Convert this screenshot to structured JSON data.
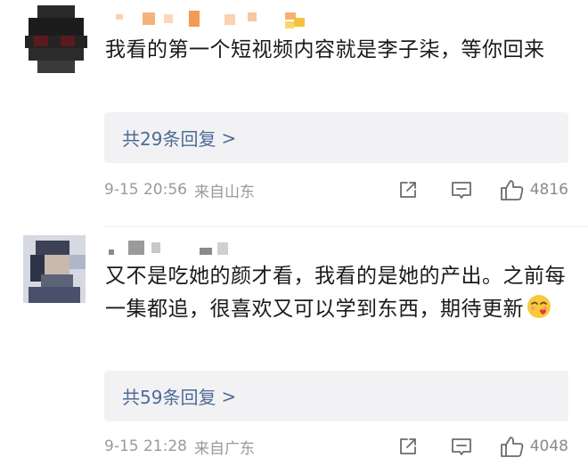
{
  "comments": [
    {
      "text": "我看的第一个短视频内容就是李子柒，等你回来",
      "reply_label": "共29条回复",
      "reply_arrow": ">",
      "time": "9-15 20:56",
      "location": "来自山东",
      "like_count": "4816",
      "icons": [
        "share-icon",
        "comment-icon",
        "like-icon"
      ]
    },
    {
      "text": "又不是吃她的颜才看，我看的是她的产出。之前每一集都追，很喜欢又可以学到东西，期待更新",
      "emoji": "smiling-face-with-heart-icon",
      "reply_label": "共59条回复",
      "reply_arrow": ">",
      "time": "9-15 21:28",
      "location": "来自广东",
      "like_count": "4048",
      "icons": [
        "share-icon",
        "comment-icon",
        "like-icon"
      ]
    }
  ],
  "colors": {
    "reply_link": "#4e6b95",
    "reply_bg": "#f2f2f5",
    "meta_gray": "#9a9a9a",
    "username_orange": "#f5a15c"
  }
}
